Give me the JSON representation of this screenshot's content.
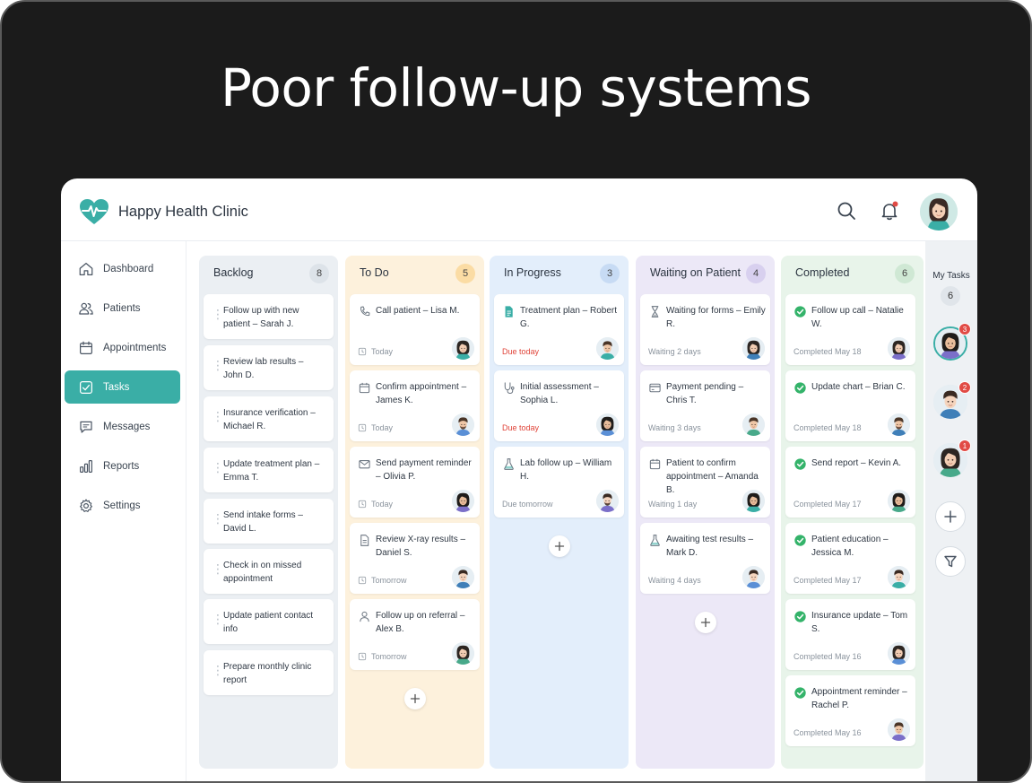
{
  "headline": "Poor follow-up systems",
  "app": {
    "name": "Happy Health Clinic",
    "accent": "#3aaea6"
  },
  "topbar": {
    "search_icon": "search-icon",
    "bell_icon": "bell-icon",
    "notification_dot_color": "#e14b45"
  },
  "sidebar": {
    "items": [
      {
        "label": "Dashboard",
        "icon": "home-icon",
        "active": false
      },
      {
        "label": "Patients",
        "icon": "users-icon",
        "active": false
      },
      {
        "label": "Appointments",
        "icon": "calendar-icon",
        "active": false
      },
      {
        "label": "Tasks",
        "icon": "checkbox-icon",
        "active": true
      },
      {
        "label": "Messages",
        "icon": "chat-icon",
        "active": false
      },
      {
        "label": "Reports",
        "icon": "bar-chart-icon",
        "active": false
      },
      {
        "label": "Settings",
        "icon": "gear-icon",
        "active": false
      }
    ]
  },
  "columns": [
    {
      "title": "Backlog",
      "count": "8",
      "bg": "#ebeff3",
      "badge_bg": "#dde3e9",
      "cards": [
        {
          "title": "Follow up with new patient – Sarah J."
        },
        {
          "title": "Review lab results – John D."
        },
        {
          "title": "Insurance verification – Michael R."
        },
        {
          "title": "Update treatment plan – Emma T."
        },
        {
          "title": "Send intake forms – David L."
        },
        {
          "title": "Check in on missed appointment"
        },
        {
          "title": "Update patient contact info"
        },
        {
          "title": "Prepare monthly clinic report"
        }
      ]
    },
    {
      "title": "To Do",
      "count": "5",
      "bg": "#fdf1dc",
      "badge_bg": "#fbdca4",
      "cards": [
        {
          "title": "Call patient – Lisa M.",
          "icon": "phone-icon",
          "meta": "Today"
        },
        {
          "title": "Confirm appointment – James K.",
          "icon": "calendar-icon",
          "meta": "Today"
        },
        {
          "title": "Send payment reminder – Olivia P.",
          "icon": "mail-icon",
          "meta": "Today"
        },
        {
          "title": "Review X-ray results – Daniel S.",
          "icon": "document-icon",
          "meta": "Tomorrow"
        },
        {
          "title": "Follow up on referral – Alex B.",
          "icon": "user-icon",
          "meta": "Tomorrow"
        }
      ]
    },
    {
      "title": "In Progress",
      "count": "3",
      "bg": "#e3eefb",
      "badge_bg": "#c7dbf4",
      "cards": [
        {
          "title": "Treatment plan – Robert G.",
          "icon": "file-icon",
          "meta": "Due today",
          "meta_red": true
        },
        {
          "title": "Initial assessment – Sophia L.",
          "icon": "stethoscope-icon",
          "meta": "Due today",
          "meta_red": true
        },
        {
          "title": "Lab follow up – William H.",
          "icon": "flask-icon",
          "meta": "Due tomorrow"
        }
      ]
    },
    {
      "title": "Waiting on Patient",
      "count": "4",
      "bg": "#ece8f7",
      "badge_bg": "#d8d0ef",
      "cards": [
        {
          "title": "Waiting for forms – Emily R.",
          "icon": "hourglass-icon",
          "meta": "Waiting 2 days"
        },
        {
          "title": "Payment pending – Chris T.",
          "icon": "credit-card-icon",
          "meta": "Waiting 3 days"
        },
        {
          "title": "Patient to confirm appointment – Amanda B.",
          "icon": "calendar-icon",
          "meta": "Waiting 1 day"
        },
        {
          "title": "Awaiting test results – Mark D.",
          "icon": "flask-icon",
          "meta": "Waiting 4 days"
        }
      ]
    },
    {
      "title": "Completed",
      "count": "6",
      "bg": "#e8f4ea",
      "badge_bg": "#cfe8d4",
      "cards": [
        {
          "title": "Follow up call – Natalie W.",
          "icon": "check-circle-icon",
          "meta": "Completed May 18"
        },
        {
          "title": "Update chart – Brian C.",
          "icon": "check-circle-icon",
          "meta": "Completed May 18"
        },
        {
          "title": "Send report – Kevin A.",
          "icon": "check-circle-icon",
          "meta": "Completed May 17"
        },
        {
          "title": "Patient education – Jessica M.",
          "icon": "check-circle-icon",
          "meta": "Completed May 17"
        },
        {
          "title": "Insurance update – Tom S.",
          "icon": "check-circle-icon",
          "meta": "Completed May 16"
        },
        {
          "title": "Appointment reminder – Rachel P.",
          "icon": "check-circle-icon",
          "meta": "Completed May 16"
        }
      ]
    }
  ],
  "rail": {
    "title": "My Tasks",
    "count": "6",
    "members": [
      {
        "badge": "3"
      },
      {
        "badge": "2"
      },
      {
        "badge": "1"
      }
    ],
    "add_icon": "plus-icon",
    "filter_icon": "filter-icon"
  }
}
